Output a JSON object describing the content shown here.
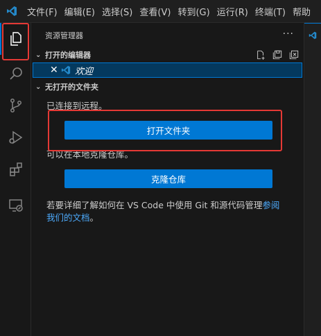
{
  "menu": [
    "文件(F)",
    "编辑(E)",
    "选择(S)",
    "查看(V)",
    "转到(G)",
    "运行(R)",
    "终端(T)",
    "帮助"
  ],
  "activity": {
    "items": [
      "files-icon",
      "search-icon",
      "source-control-icon",
      "run-debug-icon",
      "extensions-icon",
      "remote-explorer-icon"
    ]
  },
  "sidebar": {
    "title": "资源管理器",
    "more": "···",
    "open_editors": {
      "label": "打开的编辑器",
      "item": "欢迎"
    },
    "no_folder": {
      "label": "无打开的文件夹",
      "connected_msg": "已连接到远程。",
      "open_folder_btn": "打开文件夹",
      "clone_msg": "可以在本地克隆仓库。",
      "clone_btn": "克隆仓库",
      "learn_prefix": "若要详细了解如何在 VS Code 中使用 Git 和源代码管理",
      "learn_link_a": "参阅",
      "learn_link_b": "我们的文档",
      "learn_suffix": "。"
    }
  },
  "colors": {
    "accent": "#0078d4",
    "highlight_box": "#e53935",
    "background": "#181818"
  }
}
